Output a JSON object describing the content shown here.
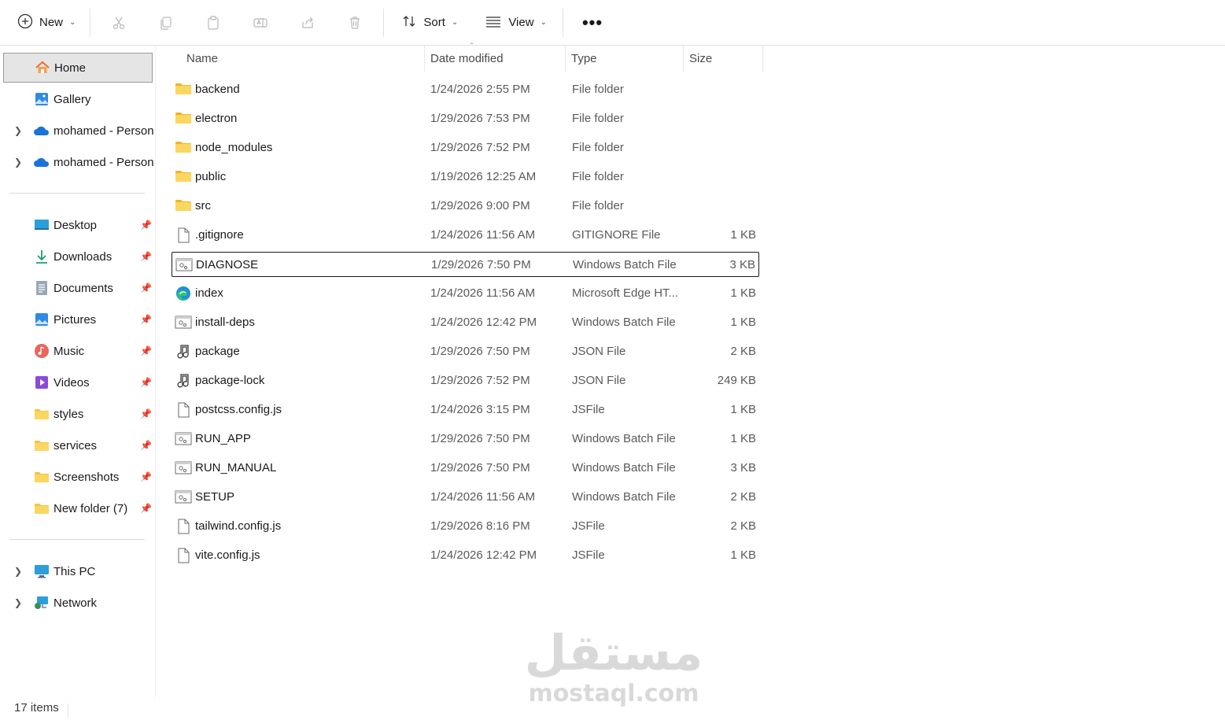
{
  "toolbar": {
    "new_label": "New",
    "sort_label": "Sort",
    "view_label": "View",
    "more_label": "•••"
  },
  "sidebar": {
    "items": [
      {
        "label": "Home",
        "icon": "home-icon"
      },
      {
        "label": "Gallery",
        "icon": "gallery-icon"
      },
      {
        "label": "mohamed - Personal",
        "icon": "onedrive-icon"
      },
      {
        "label": "mohamed - Personal",
        "icon": "onedrive-icon"
      },
      {
        "label": "Desktop",
        "icon": "desktop-icon"
      },
      {
        "label": "Downloads",
        "icon": "download-icon"
      },
      {
        "label": "Documents",
        "icon": "documents-icon"
      },
      {
        "label": "Pictures",
        "icon": "pictures-icon"
      },
      {
        "label": "Music",
        "icon": "music-icon"
      },
      {
        "label": "Videos",
        "icon": "videos-icon"
      },
      {
        "label": "styles",
        "icon": "folder-icon"
      },
      {
        "label": "services",
        "icon": "folder-icon"
      },
      {
        "label": "Screenshots",
        "icon": "folder-icon"
      },
      {
        "label": "New folder (7)",
        "icon": "folder-icon"
      },
      {
        "label": "This PC",
        "icon": "pc-icon"
      },
      {
        "label": "Network",
        "icon": "network-icon"
      }
    ]
  },
  "columns": {
    "name": "Name",
    "date": "Date modified",
    "type": "Type",
    "size": "Size"
  },
  "files": [
    {
      "name": "backend",
      "date": "1/24/2026 2:55 PM",
      "type": "File folder",
      "size": "",
      "icon": "folder"
    },
    {
      "name": "electron",
      "date": "1/29/2026 7:53 PM",
      "type": "File folder",
      "size": "",
      "icon": "folder"
    },
    {
      "name": "node_modules",
      "date": "1/29/2026 7:52 PM",
      "type": "File folder",
      "size": "",
      "icon": "folder"
    },
    {
      "name": "public",
      "date": "1/19/2026 12:25 AM",
      "type": "File folder",
      "size": "",
      "icon": "folder"
    },
    {
      "name": "src",
      "date": "1/29/2026 9:00 PM",
      "type": "File folder",
      "size": "",
      "icon": "folder"
    },
    {
      "name": ".gitignore",
      "date": "1/24/2026 11:56 AM",
      "type": "GITIGNORE File",
      "size": "1 KB",
      "icon": "file"
    },
    {
      "name": "DIAGNOSE",
      "date": "1/29/2026 7:50 PM",
      "type": "Windows Batch File",
      "size": "3 KB",
      "icon": "batch"
    },
    {
      "name": "index",
      "date": "1/24/2026 11:56 AM",
      "type": "Microsoft Edge HT...",
      "size": "1 KB",
      "icon": "edge"
    },
    {
      "name": "install-deps",
      "date": "1/24/2026 12:42 PM",
      "type": "Windows Batch File",
      "size": "1 KB",
      "icon": "batch"
    },
    {
      "name": "package",
      "date": "1/29/2026 7:50 PM",
      "type": "JSON File",
      "size": "2 KB",
      "icon": "json"
    },
    {
      "name": "package-lock",
      "date": "1/29/2026 7:52 PM",
      "type": "JSON File",
      "size": "249 KB",
      "icon": "json"
    },
    {
      "name": "postcss.config.js",
      "date": "1/24/2026 3:15 PM",
      "type": "JSFile",
      "size": "1 KB",
      "icon": "file"
    },
    {
      "name": "RUN_APP",
      "date": "1/29/2026 7:50 PM",
      "type": "Windows Batch File",
      "size": "1 KB",
      "icon": "batch"
    },
    {
      "name": "RUN_MANUAL",
      "date": "1/29/2026 7:50 PM",
      "type": "Windows Batch File",
      "size": "3 KB",
      "icon": "batch"
    },
    {
      "name": "SETUP",
      "date": "1/24/2026 11:56 AM",
      "type": "Windows Batch File",
      "size": "2 KB",
      "icon": "batch"
    },
    {
      "name": "tailwind.config.js",
      "date": "1/29/2026 8:16 PM",
      "type": "JSFile",
      "size": "2 KB",
      "icon": "file"
    },
    {
      "name": "vite.config.js",
      "date": "1/24/2026 12:42 PM",
      "type": "JSFile",
      "size": "1 KB",
      "icon": "file"
    }
  ],
  "status": {
    "item_count": "17 items"
  },
  "watermark": {
    "arabic": "مستقل",
    "latin": "mostaql.com"
  },
  "colors": {
    "folder": "#f4c542",
    "accent": "#0067c0",
    "selected_bg": "#e5e5e5"
  }
}
